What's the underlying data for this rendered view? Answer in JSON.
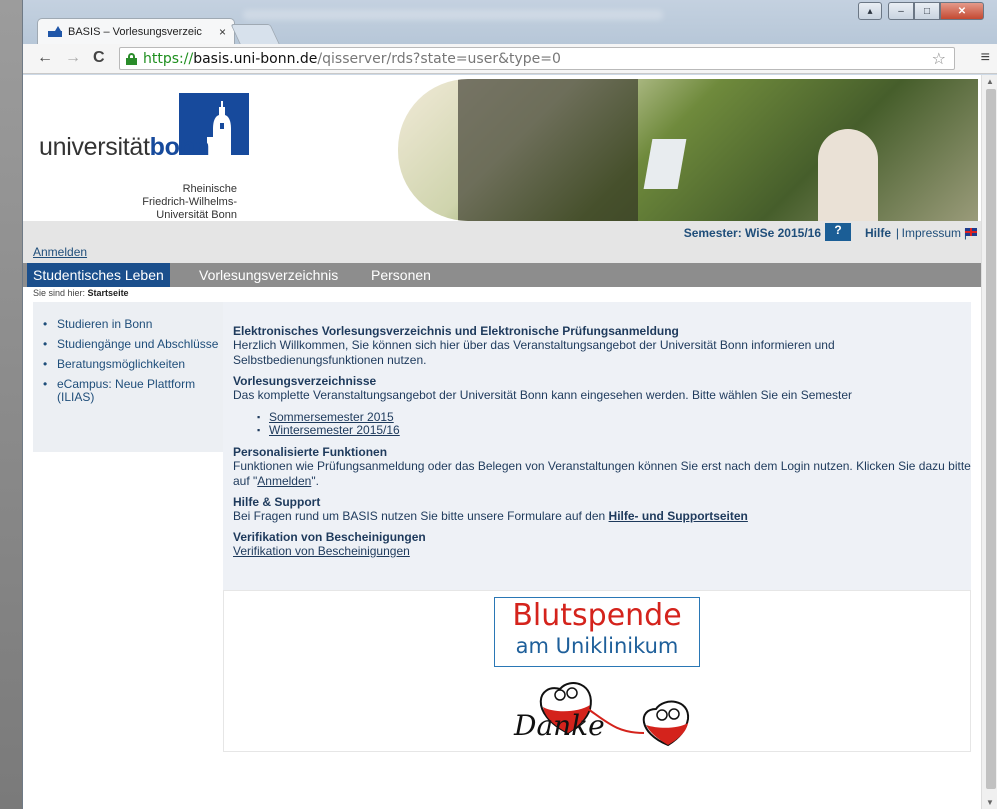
{
  "browser": {
    "tab_title": "BASIS – Vorlesungsverzeic",
    "tab_close": "×",
    "url_protocol": "https://",
    "url_host": "basis.uni-bonn.de",
    "url_path": "/qisserver/rds?state=user&type=0",
    "nav": {
      "back": "←",
      "forward": "→",
      "reload": "C"
    },
    "star": "☆",
    "menu": "≡",
    "window": {
      "minimize": "–",
      "maximize": "□",
      "close": "✕"
    }
  },
  "logo": {
    "wordmark_light": "universität",
    "wordmark_bold": "bonn",
    "sub_line1": "Rheinische",
    "sub_line2": "Friedrich-Wilhelms-",
    "sub_line3": "Universität Bonn"
  },
  "header": {
    "semester": "Semester: WiSe 2015/16",
    "help_icon_text": "?",
    "help_label": "Hilfe",
    "impressum_label": "Impressum",
    "separator": "|",
    "login_link": "Anmelden"
  },
  "menu": {
    "items": [
      "Studentisches Leben",
      "Vorlesungsverzeichnis",
      "Personen"
    ]
  },
  "breadcrumb": {
    "prefix": "Sie sind hier:",
    "current": "Startseite"
  },
  "sidebar": {
    "items": [
      "Studieren in Bonn",
      "Studiengänge und Abschlüsse",
      "Beratungsmöglichkeiten",
      "eCampus: Neue Plattform (ILIAS)"
    ]
  },
  "content": {
    "title": "Elektronisches Vorlesungsverzeichnis und Elektronische Prüfungsanmeldung",
    "welcome": "Herzlich Willkommen, Sie können sich hier über das Veranstaltungsangebot der Universität Bonn informieren und Selbstbedienungsfunktionen nutzen.",
    "vv_heading": "Vorlesungsverzeichnisse",
    "vv_text": "Das komplette Veranstaltungsangebot der Universität Bonn kann eingesehen werden. Bitte wählen Sie ein Semester",
    "semesters": [
      "Sommersemester 2015",
      "Wintersemester 2015/16"
    ],
    "pers_heading": "Personalisierte Funktionen",
    "pers_text_before": "Funktionen wie Prüfungsanmeldung oder das Belegen von Veranstaltungen können Sie erst nach dem Login nutzen. Klicken Sie dazu bitte auf \"",
    "pers_link": "Anmelden",
    "pers_text_after": "\".",
    "help_heading": "Hilfe & Support",
    "help_text": "Bei Fragen rund um BASIS nutzen Sie bitte unsere Formulare auf den ",
    "help_link": "Hilfe- und Supportseiten",
    "verif_heading": "Verifikation von Bescheinigungen",
    "verif_link": "Verifikation von Bescheinigungen"
  },
  "banner": {
    "line1": "Blutspende",
    "line2": "am Uniklinikum",
    "danke": "Danke"
  },
  "colors": {
    "brand_blue": "#174a9c",
    "menu_active": "#1b4f8c",
    "menu_bar": "#8d8d8d",
    "link_text": "#1e3a5c",
    "blood_red": "#d4231c"
  }
}
